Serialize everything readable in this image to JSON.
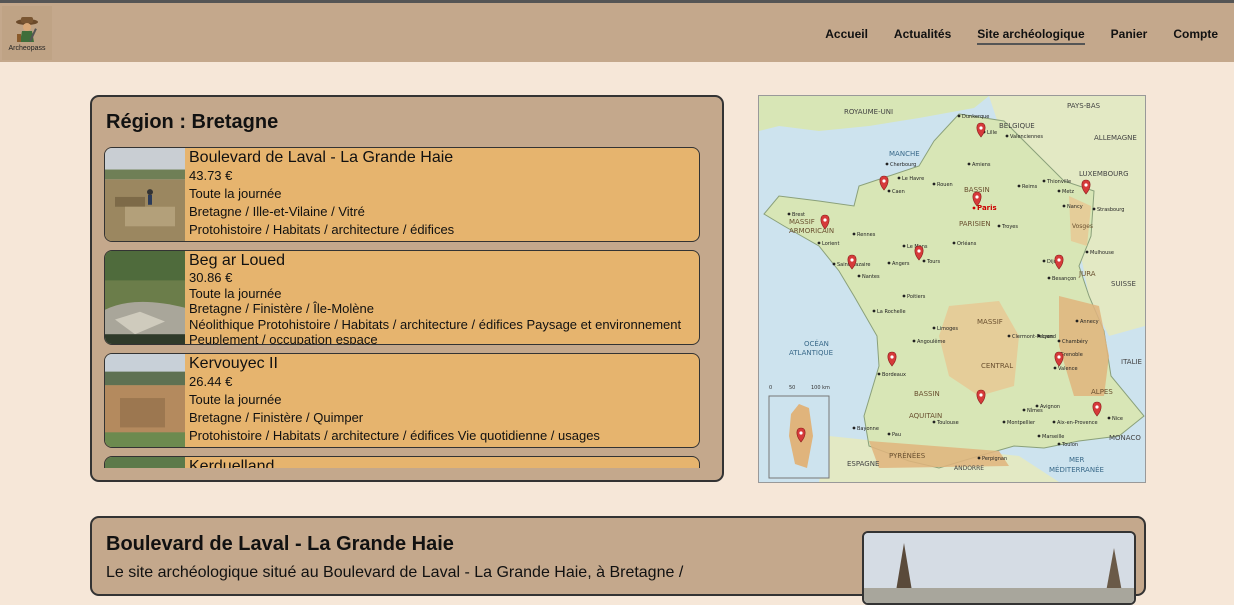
{
  "brand": {
    "name": "Archeopass"
  },
  "nav": {
    "links": [
      "Accueil",
      "Actualités",
      "Site archéologique",
      "Panier",
      "Compte"
    ],
    "active": "Site archéologique"
  },
  "region": {
    "title": "Région : Bretagne"
  },
  "sites": [
    {
      "name": "Boulevard de Laval - La Grande Haie",
      "price": "43.73 €",
      "schedule": "Toute la journée",
      "location": "Bretagne / Ille-et-Vilaine / Vitré",
      "tags": "Protohistoire / Habitats / architecture / édifices"
    },
    {
      "name": "Beg ar Loued",
      "price": "30.86 €",
      "schedule": "Toute la journée",
      "location": "Bretagne / Finistère / Île-Molène",
      "tags": "Néolithique Protohistoire / Habitats / architecture / édifices Paysage et environnement Peuplement / occupation espace"
    },
    {
      "name": "Kervouyec II",
      "price": "26.44 €",
      "schedule": "Toute la journée",
      "location": "Bretagne / Finistère / Quimper",
      "tags": "Protohistoire / Habitats / architecture / édifices Vie quotidienne / usages"
    },
    {
      "name": "Kerduelland"
    }
  ],
  "map": {
    "countries": [
      "ROYAUME-UNI",
      "BELGIQUE",
      "ALLEMAGNE",
      "LUXEMBOURG",
      "SUISSE",
      "ITALIE",
      "ESPAGNE",
      "ANDORRE",
      "MONACO",
      "PAYS-BAS"
    ],
    "seas": [
      "MANCHE",
      "OCÉAN",
      "ATLANTIQUE",
      "MER",
      "MÉDITERRANÉE"
    ],
    "regions": [
      "MASSIF",
      "ARMORICAIN",
      "BASSIN",
      "PARISIEN",
      "MASSIF",
      "CENTRAL",
      "BASSIN",
      "AQUITAIN",
      "PYRÉNÉES",
      "JURA",
      "Vosges",
      "ALPES"
    ],
    "cities": [
      "Dunkerque",
      "Lille",
      "Amiens",
      "Le Havre",
      "Rouen",
      "Caen",
      "Reims",
      "Paris",
      "Metz",
      "Nancy",
      "Strasbourg",
      "Brest",
      "Rennes",
      "Lorient",
      "Saint-Nazaire",
      "Nantes",
      "Angers",
      "Le Mans",
      "Tours",
      "Orléans",
      "Dijon",
      "Besançon",
      "Mulhouse",
      "Poitiers",
      "La Rochelle",
      "Limoges",
      "Clermont-Ferrand",
      "Lyon",
      "Annecy",
      "Grenoble",
      "Valence",
      "Bordeaux",
      "Toulouse",
      "Montpellier",
      "Nîmes",
      "Avignon",
      "Marseille",
      "Aix-en-Provence",
      "Toulon",
      "Nice",
      "Perpignan",
      "Pau",
      "Bayonne",
      "Angoulême",
      "Chambéry",
      "Troyes",
      "Thionville",
      "Valenciennes",
      "Cherbourg"
    ],
    "scale": [
      "0",
      "50",
      "100 km"
    ],
    "colors": {
      "land": "#d8e6b6",
      "sea": "#cde3ee",
      "highland": "#e8c894",
      "pin": "#d63a3a"
    }
  },
  "detail": {
    "title": "Boulevard de Laval - La Grande Haie",
    "text": "Le site archéologique situé au Boulevard de Laval - La Grande Haie, à Bretagne /"
  }
}
